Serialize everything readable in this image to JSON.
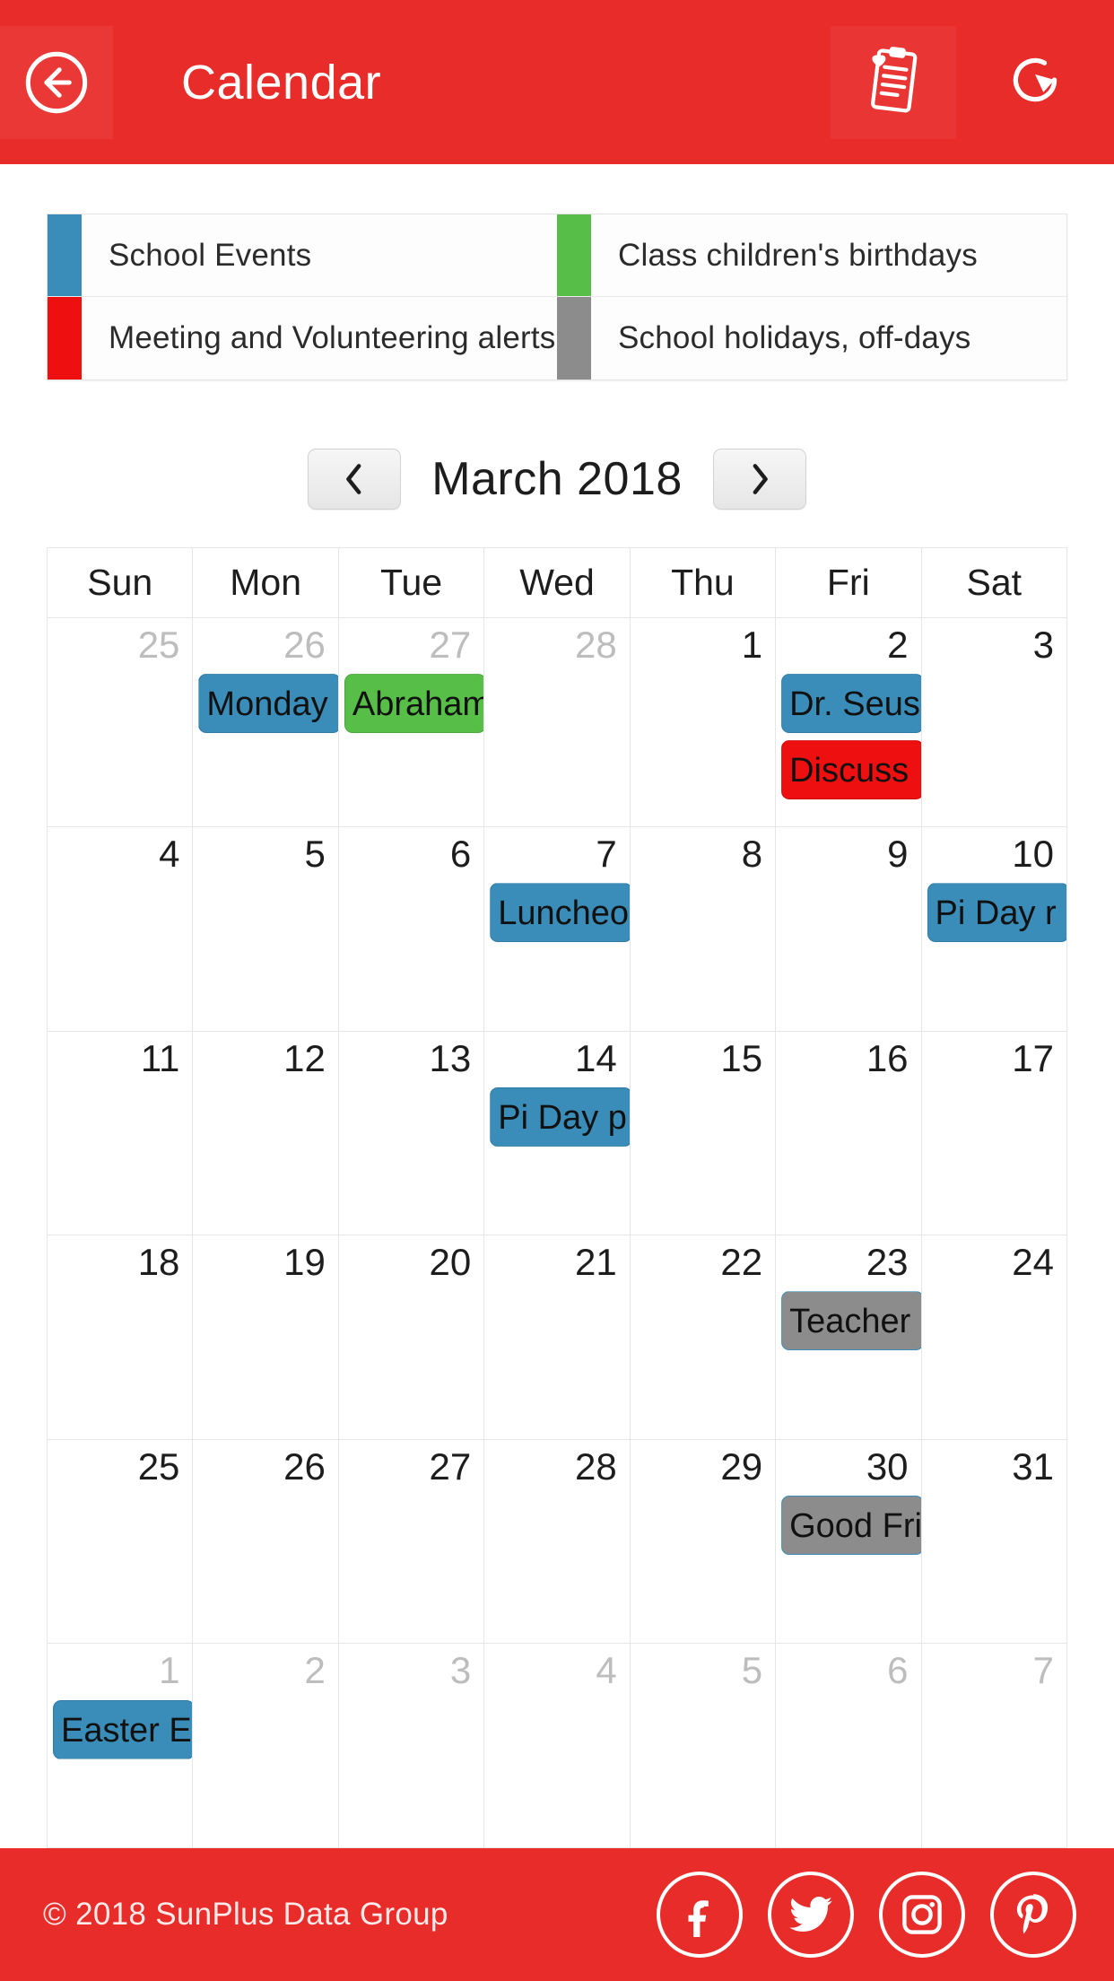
{
  "header": {
    "title": "Calendar",
    "back_icon": "back-arrow-circle-icon",
    "notes_icon": "clipboard-heart-icon",
    "refresh_icon": "refresh-icon"
  },
  "legend": {
    "items": [
      {
        "label": "School Events",
        "color": "#3a8db8"
      },
      {
        "label": "Class children's birthdays",
        "color": "#57bf47"
      },
      {
        "label": "Meeting and Volunteering alerts",
        "color": "#ee1010"
      },
      {
        "label": "School holidays, off-days",
        "color": "#8c8c8c"
      }
    ]
  },
  "month_nav": {
    "prev_label": "‹",
    "next_label": "›",
    "current_month": "March 2018"
  },
  "calendar": {
    "weekdays": [
      "Sun",
      "Mon",
      "Tue",
      "Wed",
      "Thu",
      "Fri",
      "Sat"
    ],
    "weeks": [
      [
        {
          "day": "25",
          "other": true,
          "events": []
        },
        {
          "day": "26",
          "other": true,
          "events": [
            {
              "text": "Monday",
              "color": "blue"
            }
          ]
        },
        {
          "day": "27",
          "other": true,
          "events": [
            {
              "text": "Abraham",
              "color": "green"
            }
          ]
        },
        {
          "day": "28",
          "other": true,
          "events": []
        },
        {
          "day": "1",
          "other": false,
          "events": []
        },
        {
          "day": "2",
          "other": false,
          "events": [
            {
              "text": "Dr. Seuss",
              "color": "blue"
            },
            {
              "text": "Discuss",
              "color": "red"
            }
          ]
        },
        {
          "day": "3",
          "other": false,
          "events": []
        }
      ],
      [
        {
          "day": "4",
          "other": false,
          "events": []
        },
        {
          "day": "5",
          "other": false,
          "events": []
        },
        {
          "day": "6",
          "other": false,
          "events": []
        },
        {
          "day": "7",
          "other": false,
          "events": [
            {
              "text": "Luncheon",
              "color": "blue"
            }
          ]
        },
        {
          "day": "8",
          "other": false,
          "events": []
        },
        {
          "day": "9",
          "other": false,
          "events": []
        },
        {
          "day": "10",
          "other": false,
          "events": [
            {
              "text": "Pi Day r",
              "color": "blue"
            }
          ]
        }
      ],
      [
        {
          "day": "11",
          "other": false,
          "events": []
        },
        {
          "day": "12",
          "other": false,
          "events": []
        },
        {
          "day": "13",
          "other": false,
          "events": []
        },
        {
          "day": "14",
          "other": false,
          "events": [
            {
              "text": "Pi Day p",
              "color": "blue"
            }
          ]
        },
        {
          "day": "15",
          "other": false,
          "events": []
        },
        {
          "day": "16",
          "other": false,
          "events": []
        },
        {
          "day": "17",
          "other": false,
          "events": []
        }
      ],
      [
        {
          "day": "18",
          "other": false,
          "events": []
        },
        {
          "day": "19",
          "other": false,
          "events": []
        },
        {
          "day": "20",
          "other": false,
          "events": []
        },
        {
          "day": "21",
          "other": false,
          "events": []
        },
        {
          "day": "22",
          "other": false,
          "events": []
        },
        {
          "day": "23",
          "other": false,
          "events": [
            {
              "text": "Teacher",
              "color": "gray"
            }
          ]
        },
        {
          "day": "24",
          "other": false,
          "events": []
        }
      ],
      [
        {
          "day": "25",
          "other": false,
          "events": []
        },
        {
          "day": "26",
          "other": false,
          "events": []
        },
        {
          "day": "27",
          "other": false,
          "events": []
        },
        {
          "day": "28",
          "other": false,
          "events": []
        },
        {
          "day": "29",
          "other": false,
          "events": []
        },
        {
          "day": "30",
          "other": false,
          "events": [
            {
              "text": "Good Fri",
              "color": "gray"
            }
          ]
        },
        {
          "day": "31",
          "other": false,
          "events": []
        }
      ],
      [
        {
          "day": "1",
          "other": true,
          "events": [
            {
              "text": "Easter E",
              "color": "blue"
            }
          ]
        },
        {
          "day": "2",
          "other": true,
          "events": []
        },
        {
          "day": "3",
          "other": true,
          "events": []
        },
        {
          "day": "4",
          "other": true,
          "events": []
        },
        {
          "day": "5",
          "other": true,
          "events": []
        },
        {
          "day": "6",
          "other": true,
          "events": []
        },
        {
          "day": "7",
          "other": true,
          "events": []
        }
      ]
    ]
  },
  "footer": {
    "copyright": "© 2018 SunPlus Data Group",
    "socials": [
      {
        "name": "facebook-icon"
      },
      {
        "name": "twitter-icon"
      },
      {
        "name": "instagram-icon"
      },
      {
        "name": "pinterest-icon"
      }
    ]
  },
  "colors": {
    "brand_red": "#e82c2a",
    "event_blue": "#3a8db8",
    "event_green": "#57bf47",
    "event_red": "#ee1010",
    "event_gray": "#8c8c8c"
  }
}
